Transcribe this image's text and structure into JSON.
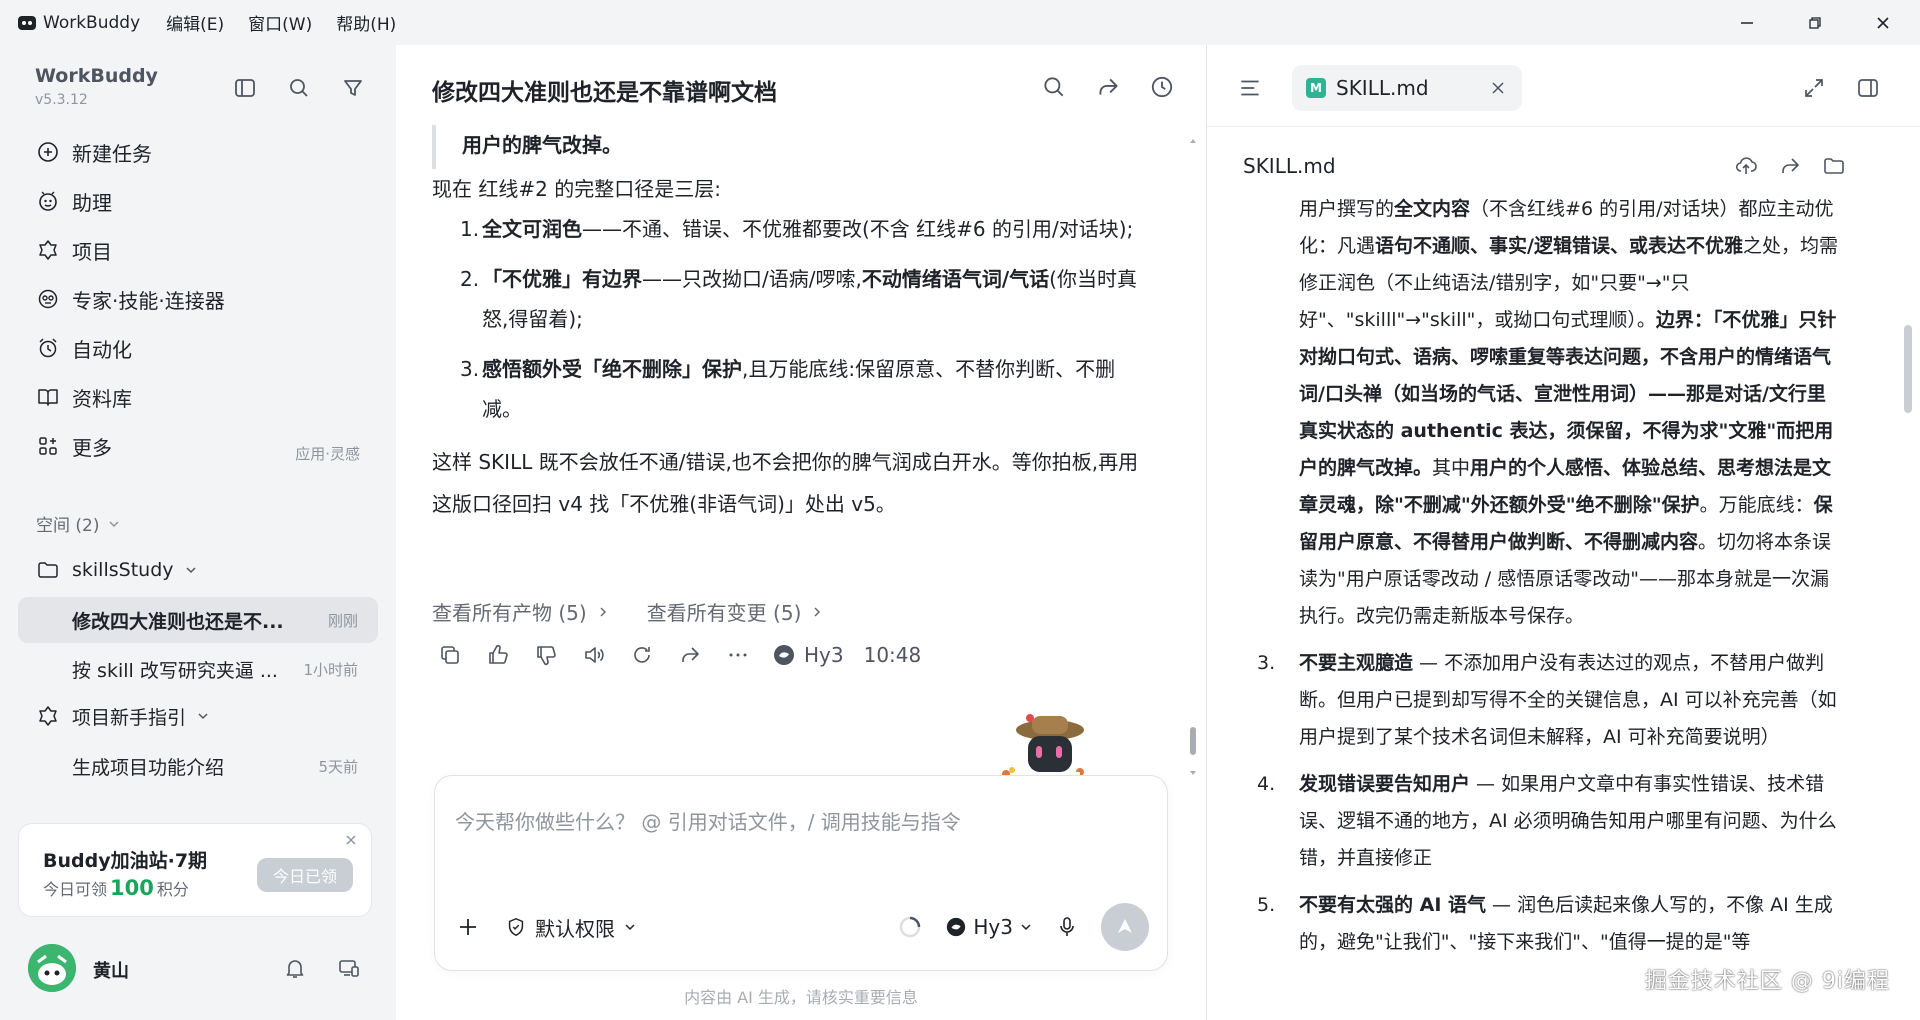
{
  "titlebar": {
    "app_name": "WorkBuddy",
    "menus": [
      "编辑(E)",
      "窗口(W)",
      "帮助(H)"
    ]
  },
  "sidebar": {
    "brand": "WorkBuddy",
    "version": "v5.3.12",
    "nav": [
      {
        "label": "新建任务",
        "icon": "plus-circle-icon"
      },
      {
        "label": "助理",
        "icon": "assistant-icon"
      },
      {
        "label": "项目",
        "icon": "project-icon"
      },
      {
        "label": "专家·技能·连接器",
        "icon": "expert-icon"
      },
      {
        "label": "自动化",
        "icon": "alarm-clock-icon"
      },
      {
        "label": "资料库",
        "icon": "book-icon"
      },
      {
        "label": "更多",
        "icon": "apps-icon"
      }
    ],
    "more_hint": "应用·灵感",
    "space_label": "空间 (2)",
    "folders": [
      {
        "label": "skillsStudy"
      },
      {
        "label": "项目新手指引"
      }
    ],
    "threads": [
      {
        "label": "修改四大准则也还是不...",
        "time": "刚刚",
        "active": true
      },
      {
        "label": "按 skill 改写研究夹逼 ...",
        "time": "1小时前",
        "active": false
      },
      {
        "label": "生成项目功能介绍",
        "time": "5天前",
        "active": false
      }
    ],
    "promo": {
      "title": "Buddy加油站·7期",
      "sub_prefix": "今日可领",
      "points": "100",
      "sub_suffix": "积分",
      "button": "今日已领"
    },
    "user": {
      "name": "黄山"
    }
  },
  "chat": {
    "title": "修改四大准则也还是不靠谱啊文档",
    "quote": "用户的脾气改掉。",
    "intro": "现在 红线#2 的完整口径是三层:",
    "items": [
      {
        "num": "1.",
        "bold": "全文可润色",
        "rest": "——不通、错误、不优雅都要改(不含 红线#6 的引用/对话块);"
      },
      {
        "num": "2.",
        "bold": "「不优雅」有边界",
        "rest": "——只改拗口/语病/啰嗦,",
        "bold2": "不动情绪语气词/气话",
        "rest2": "(你当时真怒,得留着);"
      },
      {
        "num": "3.",
        "bold": "感悟额外受「绝不删除」保护",
        "rest": ",且万能底线:保留原意、不替你判断、不删减。"
      }
    ],
    "closing": "这样 SKILL 既不会放任不通/错误,也不会把你的脾气润成白开水。等你拍板,再用这版口径回扫 v4 找「不优雅(非语气词)」处出 v5。",
    "link_artifacts": "查看所有产物 (5)",
    "link_changes": "查看所有变更 (5)",
    "model": "Hy3",
    "time": "10:48",
    "composer_placeholder": "今天帮你做些什么？ @ 引用对话文件，/ 调用技能与指令",
    "permission": "默认权限",
    "composer_model": "Hy3",
    "disclaimer": "内容由 AI 生成，请核实重要信息"
  },
  "doc": {
    "tab_label": "SKILL.md",
    "tab_badge": "M",
    "file_name": "SKILL.md",
    "block": {
      "t1": "用户撰写的",
      "b1": "全文内容",
      "t2": "（不含红线#6 的引用/对话块）都应主动优化：凡遇",
      "b2": "语句不通顺、事实/逻辑错误、或表达不优雅",
      "t3": "之处，均需修正润色（不止纯语法/错别字，如\"只要\"→\"只好\"、\"skilll\"→\"skill\"，或拗口句式理顺）。",
      "b3": "边界：「不优雅」只针对拗口句式、语病、啰嗦重复等表达问题，不含用户的情绪语气词/口头禅（如当场的气话、宣泄性用词）——那是对话/文行里真实状态的 authentic 表达，须保留，不得为求\"文雅\"而把用户的脾气改掉。",
      "t4": "其中",
      "b4": "用户的个人感悟、体验总结、思考想法是文章灵魂，除\"不删减\"外还额外受\"绝不删除\"保护",
      "t5": "。万能底线：",
      "b5": "保留用户原意、不得替用户做判断、不得删减内容",
      "t6": "。切勿将本条误读为\"用户原话零改动 / 感悟原话零改动\"——那本身就是一次漏执行。改完仍需走新版本号保存。"
    },
    "items": [
      {
        "num": "3.",
        "bold": "不要主观臆造",
        "rest": " — 不添加用户没有表达过的观点，不替用户做判断。但用户已提到却写得不全的关键信息，AI 可以补充完善（如用户提到了某个技术名词但未解释，AI 可补充简要说明）"
      },
      {
        "num": "4.",
        "bold": "发现错误要告知用户",
        "rest": " — 如果用户文章中有事实性错误、技术错误、逻辑不通的地方，AI 必须明确告知用户哪里有问题、为什么错，并直接修正"
      },
      {
        "num": "5.",
        "bold": "不要有太强的 AI 语气",
        "rest": " — 润色后读起来像人写的，不像 AI 生成的，避免\"让我们\"、\"接下来我们\"、\"值得一提的是\"等"
      }
    ],
    "watermark": "掘金技术社区 @ 9i编程"
  },
  "colors": {
    "sidebar_bg": "#f3f4f6",
    "active_thread_bg": "#e3e5e8",
    "points_green": "#1aa55c",
    "md_badge": "#2fb394"
  }
}
